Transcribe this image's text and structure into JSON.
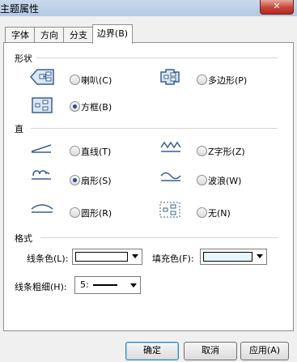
{
  "window": {
    "title": "主题属性",
    "close_glyph": "✕"
  },
  "tabs": [
    {
      "label": "字体"
    },
    {
      "label": "方向"
    },
    {
      "label": "分支"
    },
    {
      "label": "边界(B)",
      "active": true
    }
  ],
  "shape_group": {
    "title": "形状",
    "options": [
      {
        "label": "喇叭(C)",
        "checked": false,
        "icon": "horn-shape-icon"
      },
      {
        "label": "多边形(P)",
        "checked": false,
        "icon": "polygon-shape-icon"
      },
      {
        "label": "方框(B)",
        "checked": true,
        "icon": "box-shape-icon"
      }
    ]
  },
  "straight_group": {
    "title": "直",
    "options": [
      {
        "label": "直线(T)",
        "checked": false,
        "icon": "straight-line-icon"
      },
      {
        "label": "Z字形(Z)",
        "checked": false,
        "icon": "zigzag-icon"
      },
      {
        "label": "扇形(S)",
        "checked": true,
        "icon": "scallop-icon"
      },
      {
        "label": "波浪(W)",
        "checked": false,
        "icon": "wave-icon"
      },
      {
        "label": "圆形(R)",
        "checked": false,
        "icon": "arc-icon"
      },
      {
        "label": "无(N)",
        "checked": false,
        "icon": "none-border-icon"
      }
    ]
  },
  "format_group": {
    "title": "格式",
    "line_color_label": "线条色(L):",
    "line_color_value": "#ffffff",
    "fill_color_label": "填充色(F):",
    "fill_color_value": "#e6f7fb",
    "line_width_label": "线条粗细(H):",
    "line_width_value": "5:"
  },
  "buttons": {
    "ok": "确定",
    "cancel": "取消",
    "apply": "应用(A)"
  },
  "colors": {
    "icon_blue": "#3b5f8f",
    "icon_fill": "#dbe7f4",
    "selected_radio": "#2b4c86"
  }
}
